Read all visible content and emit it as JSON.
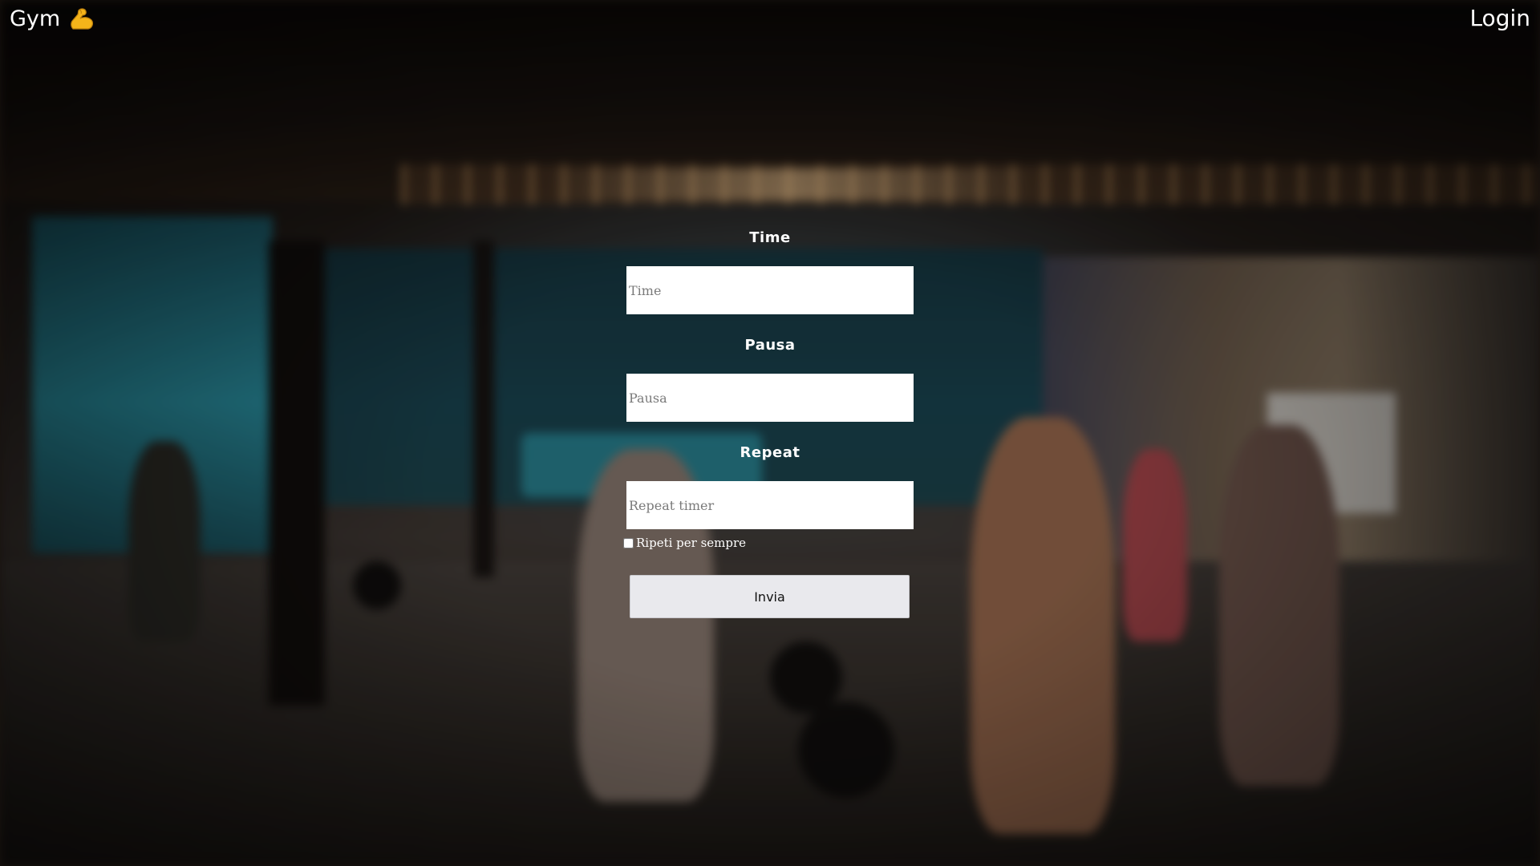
{
  "header": {
    "brand_text": "Gym",
    "brand_icon": "flexed-biceps-icon",
    "login_label": "Login"
  },
  "form": {
    "time": {
      "label": "Time",
      "placeholder": "Time"
    },
    "pause": {
      "label": "Pausa",
      "placeholder": "Pausa"
    },
    "repeat": {
      "label": "Repeat",
      "placeholder": "Repeat timer"
    },
    "repeat_forever_label": "Ripeti per sempre",
    "repeat_forever_checked": false,
    "submit_label": "Invia"
  },
  "colors": {
    "text": "#ffffff",
    "input_background": "#ffffff",
    "button_background": "#e9e9ed",
    "muscle_emoji": "#f4b41a"
  }
}
